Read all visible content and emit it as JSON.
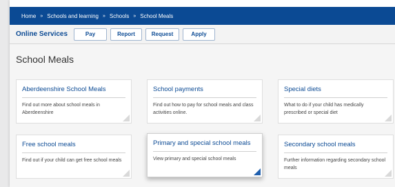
{
  "breadcrumb": {
    "items": [
      "Home",
      "Schools and learning",
      "Schools",
      "School Meals"
    ],
    "separator": "»"
  },
  "services": {
    "title": "Online Services",
    "buttons": [
      "Pay",
      "Report",
      "Request",
      "Apply"
    ]
  },
  "page": {
    "title": "School Meals"
  },
  "cards": [
    {
      "title": "Aberdeenshire School Meals",
      "description": "Find out more about school meals in Aberdeenshire",
      "corner": "grey"
    },
    {
      "title": "School payments",
      "description": "Find out how to pay for school meals and class activities online.",
      "corner": "grey"
    },
    {
      "title": "Special diets",
      "description": "What to do if your child has medically prescribed or special diet",
      "corner": "grey"
    },
    {
      "title": "Free school meals",
      "description": "Find out if your child can get free school meals",
      "corner": "grey"
    },
    {
      "title": "Primary and special school meals",
      "description": "View primary and special school meals",
      "corner": "blue"
    },
    {
      "title": "Secondary school meals",
      "description": "Further information regarding secondary school meals",
      "corner": "grey"
    }
  ],
  "colors": {
    "brand_blue": "#0b4a94",
    "corner_grey": "#d9d9d9",
    "corner_blue": "#1f5fae"
  }
}
